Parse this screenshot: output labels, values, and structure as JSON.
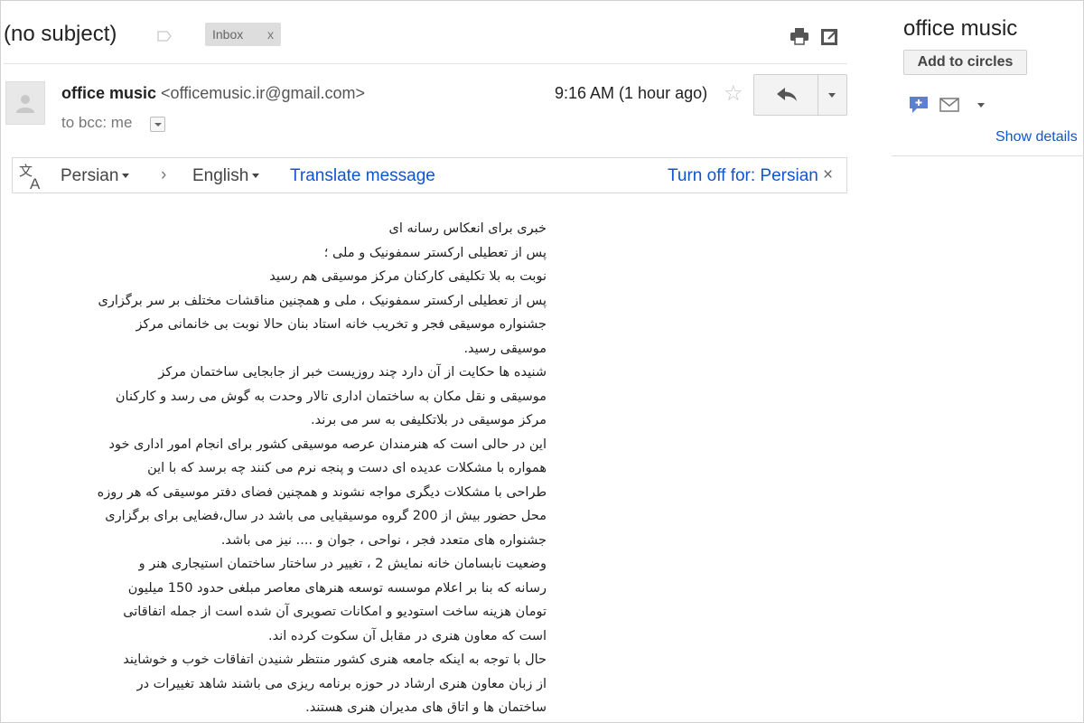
{
  "message": {
    "subject": "(no subject)",
    "label_chip": "Inbox",
    "label_chip_remove": "x"
  },
  "header": {
    "sender_name": "office music",
    "sender_email": "<officemusic.ir@gmail.com>",
    "recipients": "to bcc: me",
    "time": "9:16 AM (1 hour ago)",
    "star": "☆"
  },
  "translate_bar": {
    "from_lang": "Persian",
    "arrow": "›",
    "to_lang": "English",
    "translate_label": "Translate message",
    "turn_off_label": "Turn off for: Persian",
    "close": "×"
  },
  "body_lines": [
    "خبری برای انعکاس رسانه ای",
    "پس از تعطیلی ارکستر سمفونیک و ملی ؛",
    "نوبت به بلا تکلیفی کارکنان مرکز موسیقی هم رسید",
    "پس از تعطیلی ارکستر سمفونیک ، ملی و همچنین مناقشات مختلف بر سر برگزاری",
    "جشنواره موسیقی فجر و تخریب خانه استاد بنان حالا نوبت بی خانمانی مرکز",
    "موسیقی رسید.",
    "شنیده ها حکایت از آن دارد چند روزیست خبر از جابجایی ساختمان مرکز",
    "موسیقی و نقل مکان به ساختمان اداری تالار وحدت به گوش می رسد و کارکنان",
    "مرکز موسیقی در بلاتکلیفی به سر می برند.",
    "این در حالی است که هنرمندان عرصه موسیقی کشور برای انجام امور اداری خود",
    "همواره با مشکلات عدیده ای دست و پنجه نرم می کنند چه برسد که با این",
    "طراحی با مشکلات دیگری مواجه نشوند و همچنین فضای دفتر موسیقی که هر روزه",
    "محل حضور بیش از 200 گروه موسیقیایی می باشد در سال،فضایی برای برگزاری",
    "جشنواره های متعدد فجر ، نواحی ، جوان و .... نیز می باشد.",
    "وضعیت نابسامان خانه نمایش 2 ، تغییر در ساختار ساختمان استیجاری هنر و",
    "رسانه که بنا بر اعلام موسسه توسعه هنرهای معاصر مبلغی حدود 150 میلیون",
    "تومان هزینه ساخت استودیو و امکانات تصویری آن شده است از جمله اتفاقاتی",
    "است که معاون هنری در مقابل آن سکوت کرده اند.",
    "حال با توجه به اینکه جامعه هنری کشور منتظر شنیدن اتفاقات خوب و خوشایند",
    "از زبان معاون هنری ارشاد در حوزه برنامه ریزی  می باشند شاهد تغییرات در",
    "ساختمان ها و اتاق های مدیران هنری هستند."
  ],
  "sidebar": {
    "contact_name": "office music",
    "add_to_circles": "Add to circles",
    "show_details": "Show details"
  },
  "icons": {
    "label": "label-outline-icon",
    "print": "print-icon",
    "new_window": "new-window-icon",
    "reply": "reply-icon",
    "translate": "translate-icon",
    "chat": "chat-icon",
    "mail": "mail-icon"
  },
  "colors": {
    "link": "#1155cc",
    "chip_bg": "#dddddd",
    "button_bg": "#f3f3f3"
  }
}
